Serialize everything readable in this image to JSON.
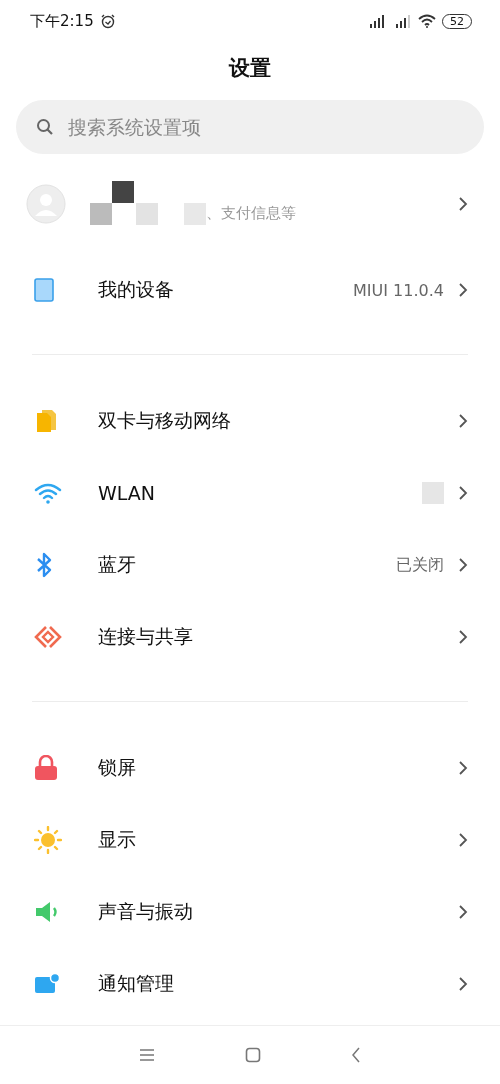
{
  "status_bar": {
    "time": "下午2:15",
    "battery": "52"
  },
  "title": "设置",
  "search": {
    "placeholder": "搜索系统设置项"
  },
  "account": {
    "subtitle": "、支付信息等"
  },
  "groups": [
    [
      {
        "label": "我的设备",
        "value": "MIUI 11.0.4"
      }
    ],
    [
      {
        "label": "双卡与移动网络"
      },
      {
        "label": "WLAN",
        "value_redacted": true
      },
      {
        "label": "蓝牙",
        "value": "已关闭"
      },
      {
        "label": "连接与共享"
      }
    ],
    [
      {
        "label": "锁屏"
      },
      {
        "label": "显示"
      },
      {
        "label": "声音与振动"
      },
      {
        "label": "通知管理"
      }
    ]
  ]
}
